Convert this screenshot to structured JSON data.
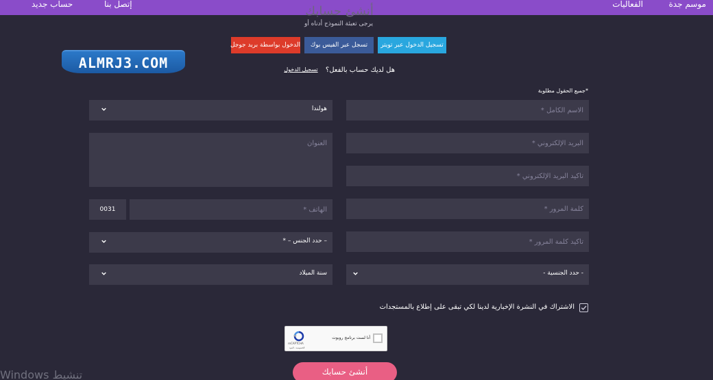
{
  "nav": {
    "items": [
      "موسم جدة",
      "الفعاليات"
    ],
    "left_items": [
      "حساب جديد",
      "إتصل بنا"
    ]
  },
  "page": {
    "title": "أنشئ حسابك",
    "subtitle": "يرجى تعبئة النموذج أدناه أو"
  },
  "social": {
    "twitter": "تسجيل الدخول عبر تويتر",
    "facebook": "تسجل عبر الفيس بوك",
    "google": "الدخول بواسطة بريد جوجل"
  },
  "logo": {
    "text": "ALMRJ3.COM"
  },
  "login": {
    "question": "هل لديك حساب بالفعل؟",
    "link": "تسجيل الدخول"
  },
  "form": {
    "required_note": "*جميع الحقول مطلوبة",
    "full_name_placeholder": "الاسم الكامل *",
    "country_value": "هولندا",
    "email_placeholder": "البريد الإلكتروني *",
    "address_placeholder": "العنوان",
    "confirm_email_placeholder": "تأكيد البريد الإلكتروني *",
    "password_placeholder": "كلمة المرور *",
    "phone_prefix": "0031",
    "phone_placeholder": "الهاتف *",
    "confirm_password_placeholder": "تأكيد كلمة المرور *",
    "gender_value": "– حدد الجنس – *",
    "nationality_value": "- حدد الجنسية -",
    "birth_year_value": "سنة الميلاد",
    "newsletter_label": "الاشتراك في النشرة الإخبارية لدينا لكي تبقى على إطلاع بالمستجدات",
    "newsletter_checked": true,
    "captcha_label": "أنا لست برنامج روبوت",
    "captcha_brand": "reCAPTCHA",
    "captcha_terms": "الخصوصية - البنود",
    "submit_label": "أنشئ حسابك"
  },
  "watermark": "Windows تنشيط",
  "colors": {
    "topbar": "#8a4cc9",
    "background": "#2a2838",
    "field": "#3c3a4a",
    "twitter": "#29a7df",
    "facebook": "#3b5b99",
    "google": "#dd3b2a",
    "submit": "#e95f84"
  }
}
